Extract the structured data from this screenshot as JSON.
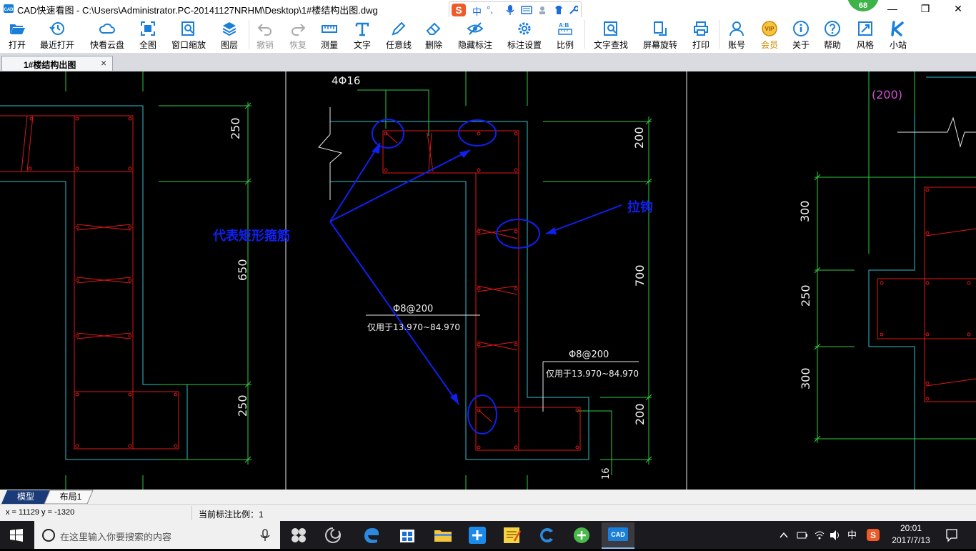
{
  "window": {
    "title": "CAD快速看图 - C:\\Users\\Administrator.PC-20141127NRHM\\Desktop\\1#楼结构出图.dwg",
    "ime_label": "中",
    "badge": "68",
    "minimize": "—",
    "maximize": "❐",
    "close": "✕"
  },
  "toolbar": {
    "open": "打开",
    "recent": "最近打开",
    "cloud": "快看云盘",
    "full_view": "全图",
    "window_zoom": "窗口缩放",
    "layers": "图层",
    "undo": "撤销",
    "redo": "恢复",
    "measure": "测量",
    "text": "文字",
    "freeline": "任意线",
    "delete": "删除",
    "hide_marks": "隐藏标注",
    "mark_settings": "标注设置",
    "scale": "比例",
    "text_search": "文字查找",
    "screen_rotate": "屏幕旋转",
    "print": "打印",
    "account": "账号",
    "member": "会员",
    "about": "关于",
    "help": "帮助",
    "style": "风格",
    "station": "小站"
  },
  "doc_tab": {
    "label": "1#楼结构出图",
    "close": "×"
  },
  "drawing": {
    "dim_250_top": "250",
    "dim_650": "650",
    "dim_250_bottom": "250",
    "rebar_4phi16": "4Φ16",
    "dim_200_top": "200",
    "dim_700": "700",
    "dim_200_bottom": "200",
    "stirrup_1": "Φ8@200",
    "range_1": "仅用于13.970~84.970",
    "stirrup_2": "Φ8@200",
    "range_2": "仅用于13.970~84.970",
    "annot_rect_stirrup": "代表矩形箍筋",
    "annot_tie": "拉钩",
    "label_200_paren": "(200)",
    "dim_300_top": "300",
    "dim_250_right": "250",
    "dim_300_bottom": "300",
    "partial_text": "16"
  },
  "layout_tabs": {
    "model": "模型",
    "layout1": "布局1"
  },
  "status": {
    "coords": "x = 11129  y = -1320",
    "scale": "当前标注比例：1"
  },
  "taskbar": {
    "search_placeholder": "在这里输入你要搜索的内容",
    "ime": "中",
    "time": "20:01",
    "date": "2017/7/13"
  },
  "colors": {
    "cad_red": "#e01818",
    "cad_cyan": "#31c0d0",
    "cad_green": "#2ecc40",
    "annotation_blue": "#1020f0",
    "magenta": "#d050d0"
  }
}
